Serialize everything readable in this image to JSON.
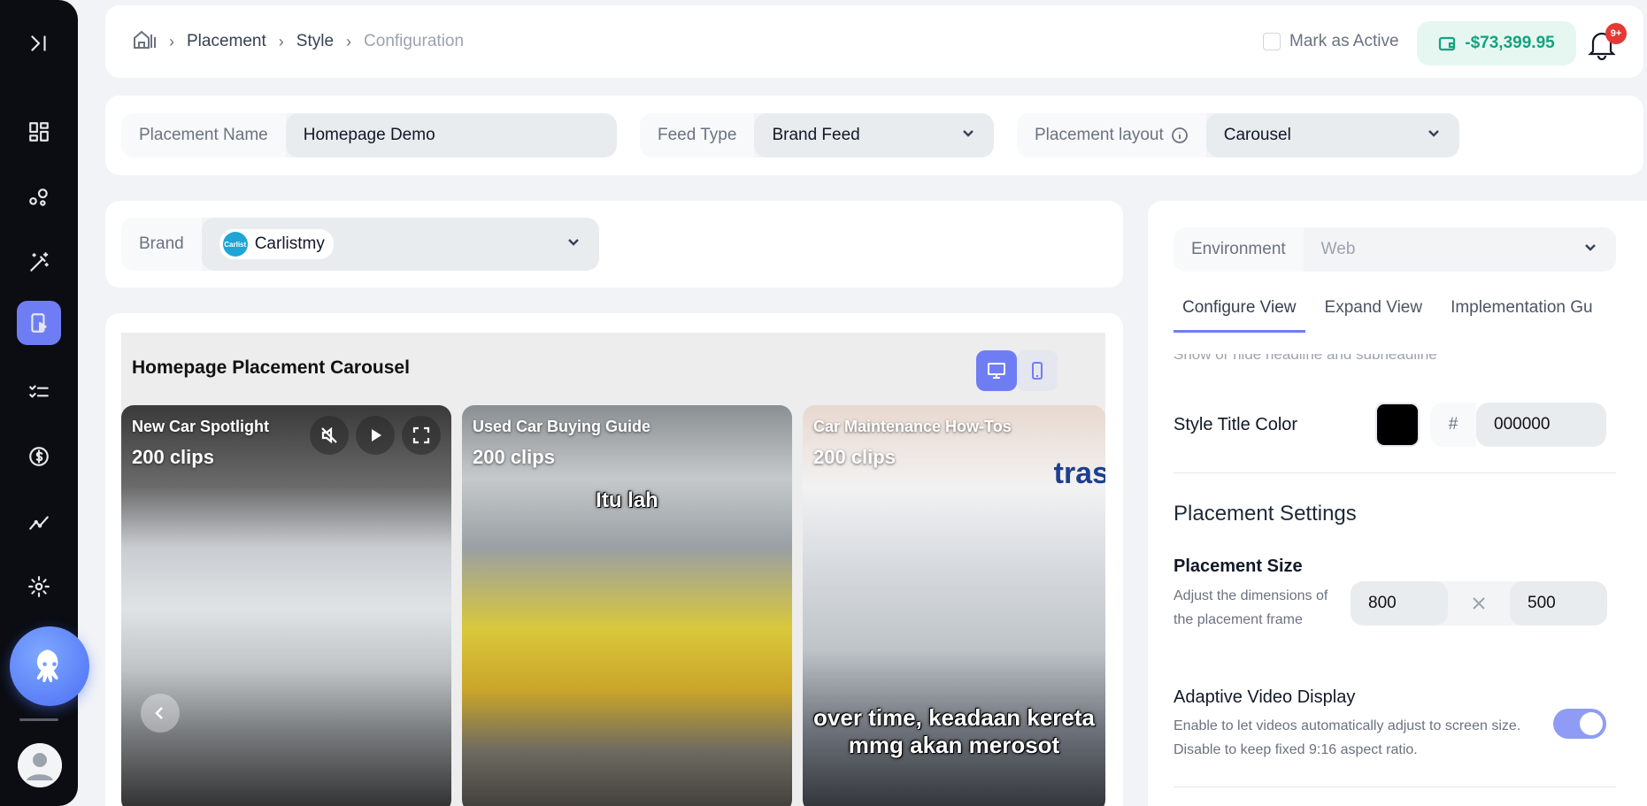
{
  "sidebar": {
    "items": [
      {
        "icon": "expand-sidebar-icon"
      },
      {
        "icon": "dashboard-icon"
      },
      {
        "icon": "shapes-icon"
      },
      {
        "icon": "magic-wand-icon"
      },
      {
        "icon": "placement-icon",
        "active": true
      },
      {
        "icon": "checklist-icon"
      },
      {
        "icon": "dollar-icon"
      },
      {
        "icon": "analytics-icon"
      },
      {
        "icon": "gear-icon"
      }
    ],
    "assistant_icon": "octopus-icon",
    "avatar_icon": "user-avatar-icon"
  },
  "header": {
    "breadcrumb": [
      "Placement",
      "Style",
      "Configuration"
    ],
    "mark_active_label": "Mark as Active",
    "balance": "-$73,399.95",
    "notification_badge": "9+"
  },
  "form": {
    "placement_name_label": "Placement Name",
    "placement_name_value": "Homepage Demo",
    "feed_type_label": "Feed Type",
    "feed_type_value": "Brand Feed",
    "layout_label": "Placement layout",
    "layout_value": "Carousel"
  },
  "brand": {
    "label": "Brand",
    "value": "Carlistmy",
    "logo_text": "Carlist"
  },
  "preview": {
    "title": "Homepage Placement Carousel",
    "cards": [
      {
        "title": "New Car Spotlight",
        "clips": "200 clips",
        "caption": ""
      },
      {
        "title": "Used Car Buying Guide",
        "clips": "200 clips",
        "caption": "Itu lah"
      },
      {
        "title": "Car Maintenance How-Tos",
        "clips": "200 clips",
        "caption": "over time, keadaan kereta\nmmg akan merosot"
      }
    ],
    "brand_watermark": "tras"
  },
  "config": {
    "environment_label": "Environment",
    "environment_value": "Web",
    "tabs": [
      "Configure View",
      "Expand View",
      "Implementation Gu"
    ],
    "cut_text": "Show or hide headline and subheadline",
    "style_title_color_label": "Style Title Color",
    "color_hash": "#",
    "color_value": "000000",
    "swatch_color": "#000000",
    "placement_settings_title": "Placement Settings",
    "placement_size_title": "Placement Size",
    "placement_size_desc": "Adjust the dimensions of the placement frame",
    "width": "800",
    "height": "500",
    "adaptive_title": "Adaptive Video Display",
    "adaptive_desc": "Enable to let videos automatically adjust to screen size. Disable to keep fixed 9:16 aspect ratio.",
    "adaptive_enabled": true,
    "accent_color": "#6f7df5"
  }
}
